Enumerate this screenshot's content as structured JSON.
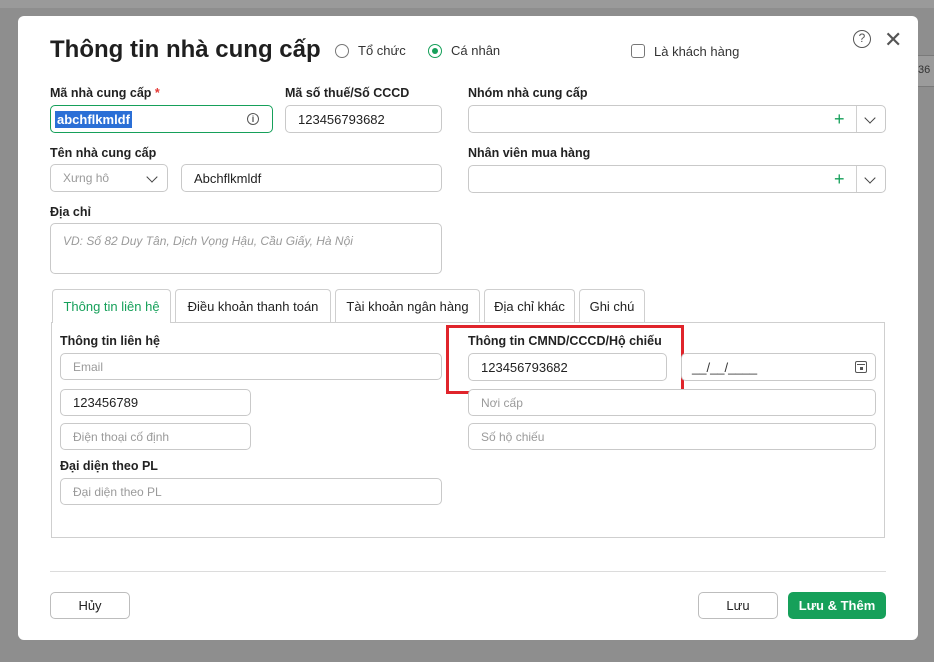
{
  "background": {
    "right_fragment": "36"
  },
  "dialog": {
    "title": "Thông tin nhà cung cấp",
    "type_options": [
      {
        "label": "Tổ chức",
        "selected": false
      },
      {
        "label": "Cá nhân",
        "selected": true
      }
    ],
    "is_customer_label": "Là khách hàng",
    "help_glyph": "?",
    "close_glyph": "✕"
  },
  "form": {
    "supplier_code": {
      "label": "Mã nhà cung cấp",
      "required_mark": "*",
      "value": "abchflkmldf"
    },
    "tax_id": {
      "label": "Mã số thuế/Số CCCD",
      "value": "123456793682"
    },
    "supplier_group": {
      "label": "Nhóm nhà cung cấp",
      "value": ""
    },
    "supplier_name": {
      "label": "Tên nhà cung cấp",
      "salutation_placeholder": "Xưng hô",
      "value": "Abchflkmldf"
    },
    "purchaser": {
      "label": "Nhân viên mua hàng",
      "value": ""
    },
    "address": {
      "label": "Địa chỉ",
      "placeholder": "VD: Số 82 Duy Tân, Dịch Vọng Hậu, Cầu Giấy, Hà Nội"
    }
  },
  "tabs": [
    {
      "label": "Thông tin liên hệ",
      "active": true
    },
    {
      "label": "Điều khoản thanh toán",
      "active": false
    },
    {
      "label": "Tài khoản ngân hàng",
      "active": false
    },
    {
      "label": "Địa chỉ khác",
      "active": false
    },
    {
      "label": "Ghi chú",
      "active": false
    }
  ],
  "contact": {
    "section_label": "Thông tin liên hệ",
    "email_placeholder": "Email",
    "phone_value": "123456789",
    "landline_placeholder": "Điện thoại cố định",
    "legal_rep_label": "Đại diện theo PL",
    "legal_rep_placeholder": "Đại diện theo PL"
  },
  "identity": {
    "section_label": "Thông tin CMND/CCCD/Hộ chiếu",
    "id_value": "123456793682",
    "date_placeholder": "__/__/____",
    "issue_place_placeholder": "Nơi cấp",
    "passport_placeholder": "Số hộ chiếu"
  },
  "footer": {
    "cancel_label": "Hủy",
    "save_label": "Lưu",
    "save_add_label": "Lưu & Thêm"
  },
  "colors": {
    "accent": "#16a05a",
    "highlight_box": "#e0242b",
    "selection": "#2b6fd6"
  }
}
